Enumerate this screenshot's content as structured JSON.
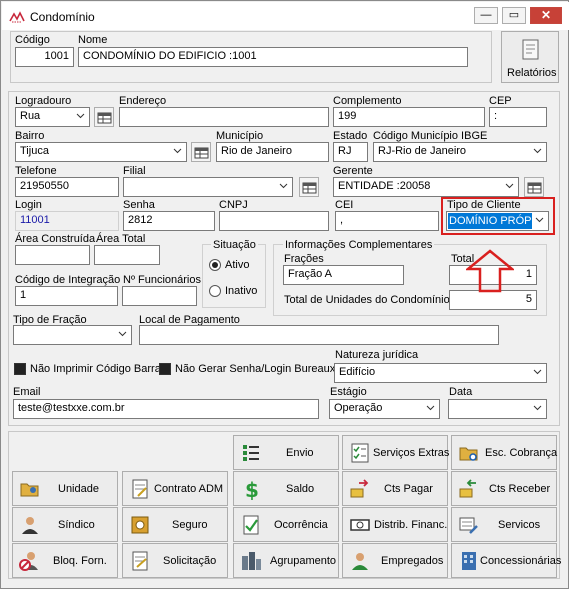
{
  "window": {
    "title": "Condomínio",
    "min": "—",
    "max": "▭",
    "close": "✕"
  },
  "header": {
    "codigo_label": "Código",
    "codigo_value": "1001",
    "nome_label": "Nome",
    "nome_value": "CONDOMÍNIO DO EDIFICIO :1001",
    "relatorios_label": "Relatórios"
  },
  "form": {
    "logradouro_label": "Logradouro",
    "logradouro_value": "Rua",
    "endereco_label": "Endereço",
    "endereco_value": "",
    "complemento_label": "Complemento",
    "complemento_value": "199",
    "cep_label": "CEP",
    "cep_value": ":",
    "bairro_label": "Bairro",
    "bairro_value": "Tijuca",
    "municipio_label": "Município",
    "municipio_value": "Rio de Janeiro",
    "estado_label": "Estado",
    "estado_value": "RJ",
    "codigo_ibge_label": "Código Município IBGE",
    "codigo_ibge_value": "RJ-Rio de Janeiro",
    "telefone_label": "Telefone",
    "telefone_value": "21950550",
    "filial_label": "Filial",
    "filial_value": "",
    "gerente_label": "Gerente",
    "gerente_value": "ENTIDADE :20058",
    "login_label": "Login",
    "login_value": "11001",
    "senha_label": "Senha",
    "senha_value": "2812",
    "cnpj_label": "CNPJ",
    "cnpj_value": "",
    "cei_label": "CEI",
    "cei_value": ",",
    "tipo_cliente_label": "Tipo de Cliente",
    "tipo_cliente_value": "DOMÍNIO PRÓPR",
    "area_construida_label": "Área Construída",
    "area_construida_value": "",
    "area_total_label": "Área Total",
    "area_total_value": "",
    "situacao_label": "Situação",
    "ativo_label": "Ativo",
    "inativo_label": "Inativo",
    "info_label": "Informações Complementares",
    "fracoes_label": "Frações",
    "fracoes_value": "Fração A",
    "total_label": "Total",
    "total_value": "1",
    "total_unidades_label": "Total de Unidades do Condomínio",
    "total_unidades_value": "5",
    "codigo_integracao_label": "Código de Integração",
    "codigo_integracao_value": "1",
    "nfuncionarios_label": "Nº Funcionários",
    "nfuncionarios_value": "",
    "tipo_fracao_label": "Tipo de Fração",
    "tipo_fracao_value": "",
    "local_pagamento_label": "Local de Pagamento",
    "local_pagamento_value": "",
    "nao_imprimir_label": "Não Imprimir Código Barra",
    "nao_gerar_label": "Não Gerar Senha/Login Bureaux",
    "natureza_label": "Natureza jurídica",
    "natureza_value": "Edifício",
    "email_label": "Email",
    "email_value": "teste@testxxe.com.br",
    "estagio_label": "Estágio",
    "estagio_value": "Operação",
    "data_label": "Data",
    "data_value": ""
  },
  "buttons": {
    "envio": "Envio",
    "servicos_extras": "Serviços Extras",
    "esc_cobranca": "Esc. Cobrança",
    "unidade": "Unidade",
    "contrato_adm": "Contrato ADM",
    "saldo": "Saldo",
    "cts_pagar": "Cts Pagar",
    "cts_receber": "Cts Receber",
    "sindico": "Síndico",
    "seguro": "Seguro",
    "ocorrencia": "Ocorrência",
    "distrib_financ": "Distrib. Financ.",
    "servicos": "Servicos",
    "bloq_forn": "Bloq. Forn.",
    "solicitacao": "Solicitação",
    "agrupamento": "Agrupamento",
    "empregados": "Empregados",
    "concessionarias": "Concessionárias"
  },
  "colors": {
    "highlight_red": "#d9201f",
    "selection_blue": "#0078d7",
    "login_blue": "#1a1aa8"
  }
}
